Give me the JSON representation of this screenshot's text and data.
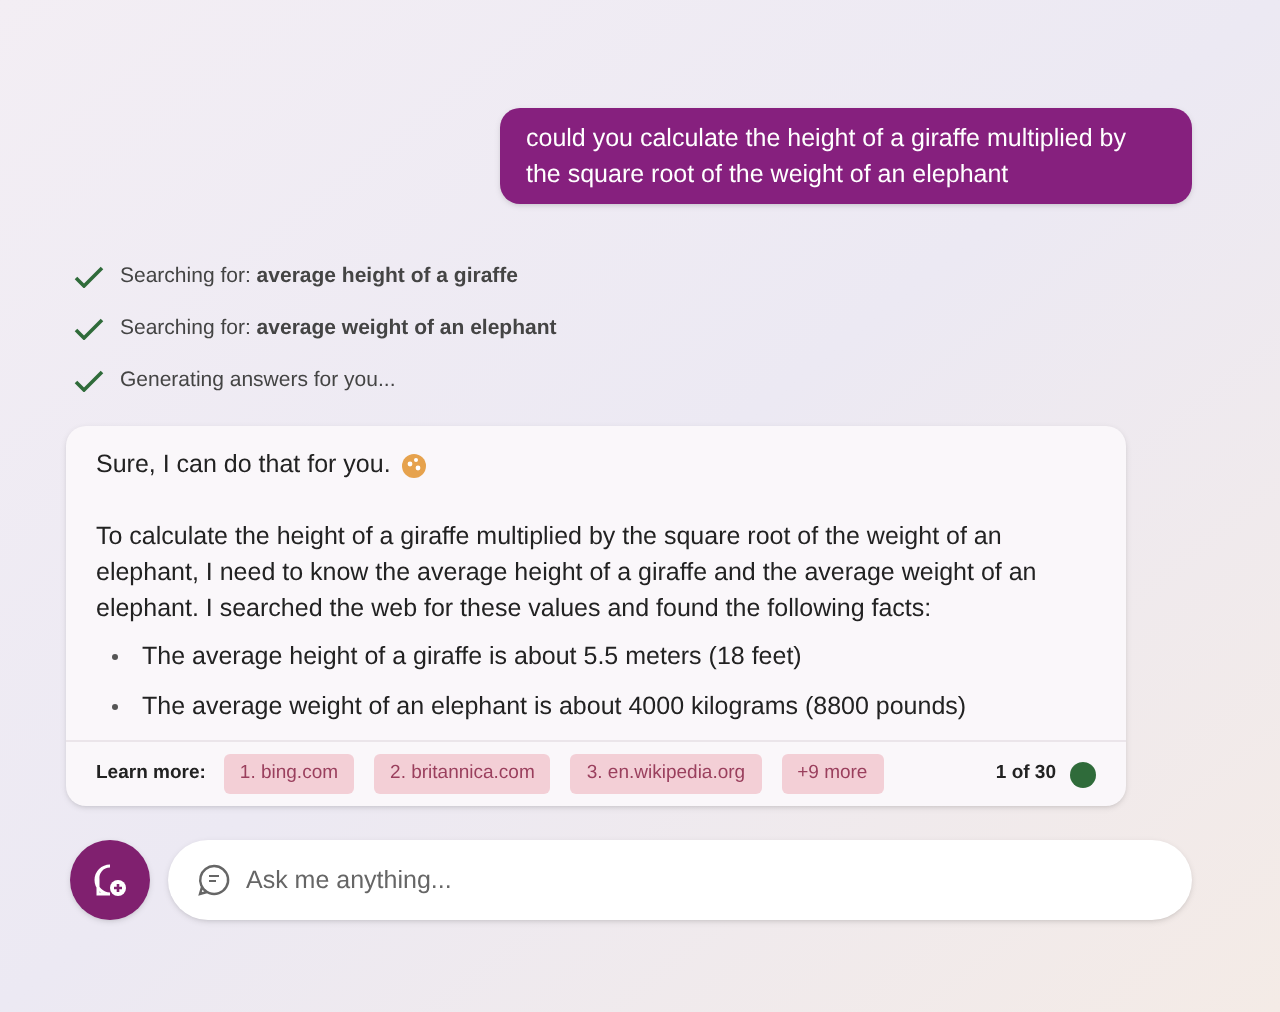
{
  "user_message": "could you calculate the height of a giraffe multiplied by the square root of the weight of an elephant",
  "steps": [
    {
      "text": "Searching for: **average height of a giraffe**",
      "done": true
    },
    {
      "text": "Searching for: **average weight of an elephant**",
      "done": true
    },
    {
      "text": "Generating answers for you...",
      "done": true
    }
  ],
  "answer": {
    "greeting": "Sure, I can do that for you.",
    "paragraph": "To calculate the height of a giraffe multiplied by the square root of the weight of an elephant, I need to know the average height of a giraffe and the average weight of an elephant. I searched the web for these values and found the following facts:",
    "bullets": [
      "The average height of a giraffe is about 5.5 meters (18 feet)",
      "The average weight of an elephant is about 4000 kilograms (8800 pounds)"
    ],
    "learn_more_label": "Learn more:",
    "sources": [
      "1. bing.com",
      "2. britannica.com",
      "3. en.wikipedia.org",
      "+9 more"
    ],
    "counter": "1 of 30"
  },
  "input": {
    "placeholder": "Ask me anything..."
  }
}
